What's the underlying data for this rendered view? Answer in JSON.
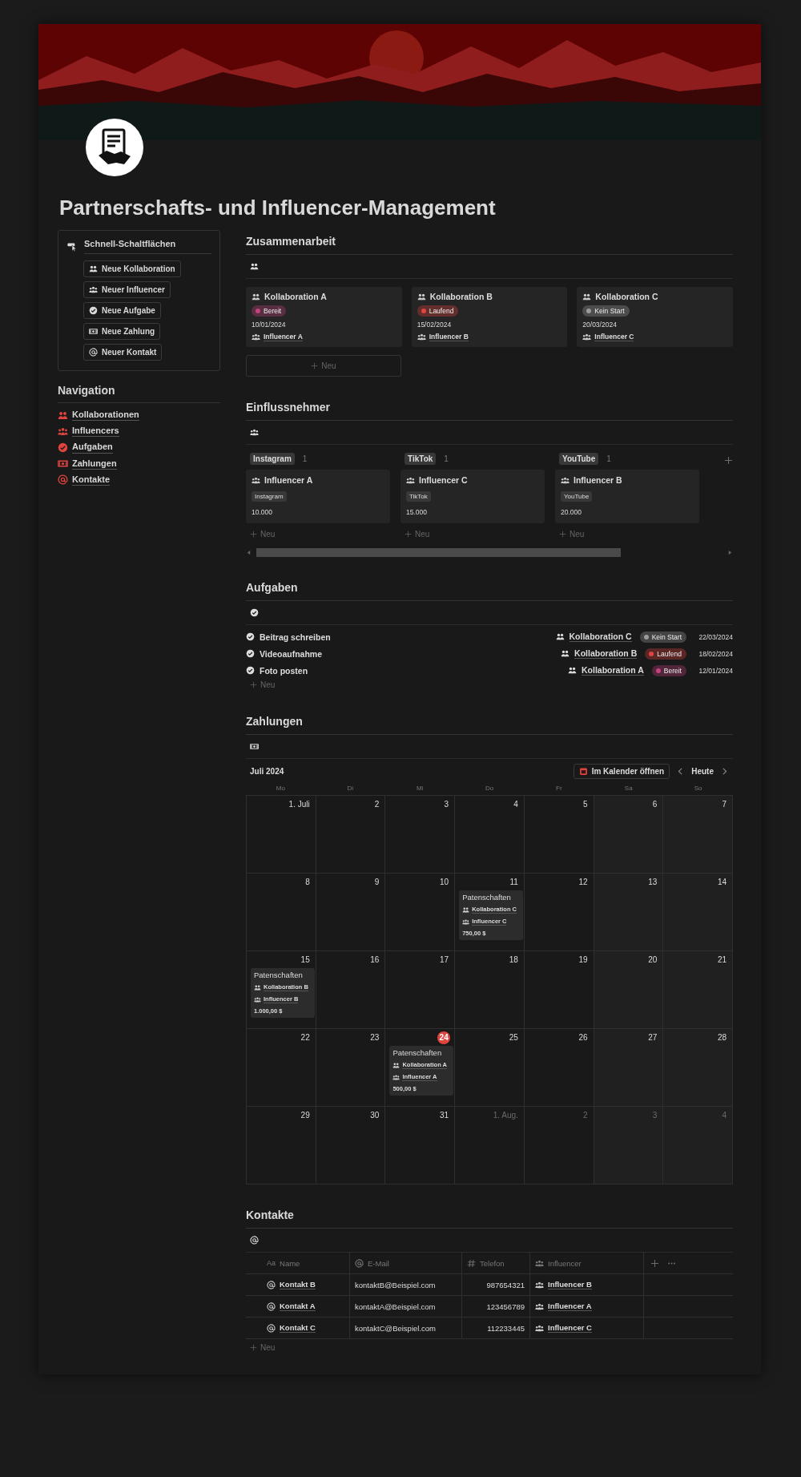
{
  "title": "Partnerschafts- und Influencer-Management",
  "quick_actions": {
    "title": "Schnell-Schaltflächen",
    "buttons": [
      {
        "label": "Neue Kollaboration",
        "kind": "collab"
      },
      {
        "label": "Neuer Influencer",
        "kind": "influencer"
      },
      {
        "label": "Neue Aufgabe",
        "kind": "task"
      },
      {
        "label": "Neue Zahlung",
        "kind": "payment"
      },
      {
        "label": "Neuer Kontakt",
        "kind": "contact"
      }
    ]
  },
  "navigation": {
    "title": "Navigation",
    "links": [
      {
        "label": "Kollaborationen",
        "kind": "collab"
      },
      {
        "label": "Influencers",
        "kind": "influencer"
      },
      {
        "label": "Aufgaben",
        "kind": "task"
      },
      {
        "label": "Zahlungen",
        "kind": "payment"
      },
      {
        "label": "Kontakte",
        "kind": "contact"
      }
    ]
  },
  "collaboration": {
    "title": "Zusammenarbeit",
    "new_label": "Neu",
    "cards": [
      {
        "name": "Kollaboration A",
        "status": {
          "label": "Bereit",
          "color": "#c4437f"
        },
        "date": "10/01/2024",
        "influencer": "Influencer A"
      },
      {
        "name": "Kollaboration B",
        "status": {
          "label": "Laufend",
          "color": "#e0443e"
        },
        "date": "15/02/2024",
        "influencer": "Influencer B"
      },
      {
        "name": "Kollaboration C",
        "status": {
          "label": "Kein Start",
          "color": "#9b9b9b"
        },
        "date": "20/03/2024",
        "influencer": "Influencer C"
      }
    ]
  },
  "influencers": {
    "title": "Einflussnehmer",
    "groups": [
      {
        "label": "Instagram",
        "count": "1",
        "new_label": "Neu",
        "cards": [
          {
            "name": "Influencer A",
            "platform": "Instagram",
            "followers": "10.000"
          }
        ]
      },
      {
        "label": "TikTok",
        "count": "1",
        "new_label": "Neu",
        "cards": [
          {
            "name": "Influencer C",
            "platform": "TikTok",
            "followers": "15.000"
          }
        ]
      },
      {
        "label": "YouTube",
        "count": "1",
        "new_label": "Neu",
        "cards": [
          {
            "name": "Influencer B",
            "platform": "YouTube",
            "followers": "20.000"
          }
        ]
      }
    ]
  },
  "tasks": {
    "title": "Aufgaben",
    "new_label": "Neu",
    "rows": [
      {
        "name": "Beitrag schreiben",
        "collaboration": "Kollaboration C",
        "status": {
          "label": "Kein Start",
          "color": "#9b9b9b"
        },
        "date": "22/03/2024"
      },
      {
        "name": "Videoaufnahme",
        "collaboration": "Kollaboration B",
        "status": {
          "label": "Laufend",
          "color": "#e0443e"
        },
        "date": "18/02/2024"
      },
      {
        "name": "Foto posten",
        "collaboration": "Kollaboration A",
        "status": {
          "label": "Bereit",
          "color": "#c4437f"
        },
        "date": "12/01/2024"
      }
    ]
  },
  "payments": {
    "title": "Zahlungen",
    "month": "Juli 2024",
    "open_button": "Im Kalender öffnen",
    "today_button": "Heute",
    "weekdays": [
      "Mo",
      "Di",
      "Mi",
      "Do",
      "Fr",
      "Sa",
      "So"
    ],
    "days": [
      {
        "label": "1. Juli",
        "in_month": true,
        "today": false
      },
      {
        "label": "2",
        "in_month": true,
        "today": false
      },
      {
        "label": "3",
        "in_month": true,
        "today": false
      },
      {
        "label": "4",
        "in_month": true,
        "today": false
      },
      {
        "label": "5",
        "in_month": true,
        "today": false
      },
      {
        "label": "6",
        "in_month": true,
        "today": false
      },
      {
        "label": "7",
        "in_month": true,
        "today": false
      },
      {
        "label": "8",
        "in_month": true,
        "today": false
      },
      {
        "label": "9",
        "in_month": true,
        "today": false
      },
      {
        "label": "10",
        "in_month": true,
        "today": false
      },
      {
        "label": "11",
        "in_month": true,
        "today": false,
        "events": [
          {
            "title": "Patenschaften",
            "collaboration": "Kollaboration C",
            "influencer": "Influencer C",
            "amount": "750,00 $"
          }
        ]
      },
      {
        "label": "12",
        "in_month": true,
        "today": false
      },
      {
        "label": "13",
        "in_month": true,
        "today": false
      },
      {
        "label": "14",
        "in_month": true,
        "today": false
      },
      {
        "label": "15",
        "in_month": true,
        "today": false,
        "events": [
          {
            "title": "Patenschaften",
            "collaboration": "Kollaboration B",
            "influencer": "Influencer B",
            "amount": "1.000,00 $"
          }
        ]
      },
      {
        "label": "16",
        "in_month": true,
        "today": false
      },
      {
        "label": "17",
        "in_month": true,
        "today": false
      },
      {
        "label": "18",
        "in_month": true,
        "today": false
      },
      {
        "label": "19",
        "in_month": true,
        "today": false
      },
      {
        "label": "20",
        "in_month": true,
        "today": false
      },
      {
        "label": "21",
        "in_month": true,
        "today": false
      },
      {
        "label": "22",
        "in_month": true,
        "today": false
      },
      {
        "label": "23",
        "in_month": true,
        "today": false
      },
      {
        "label": "24",
        "in_month": true,
        "today": true,
        "events": [
          {
            "title": "Patenschaften",
            "collaboration": "Kollaboration A",
            "influencer": "Influencer A",
            "amount": "500,00 $"
          }
        ]
      },
      {
        "label": "25",
        "in_month": true,
        "today": false
      },
      {
        "label": "26",
        "in_month": true,
        "today": false
      },
      {
        "label": "27",
        "in_month": true,
        "today": false
      },
      {
        "label": "28",
        "in_month": true,
        "today": false
      },
      {
        "label": "29",
        "in_month": true,
        "today": false
      },
      {
        "label": "30",
        "in_month": true,
        "today": false
      },
      {
        "label": "31",
        "in_month": true,
        "today": false
      },
      {
        "label": "1. Aug.",
        "in_month": false,
        "today": false
      },
      {
        "label": "2",
        "in_month": false,
        "today": false
      },
      {
        "label": "3",
        "in_month": false,
        "today": false
      },
      {
        "label": "4",
        "in_month": false,
        "today": false
      }
    ]
  },
  "contacts": {
    "title": "Kontakte",
    "new_label": "Neu",
    "columns": [
      {
        "label": "Name",
        "kind": "title",
        "glyph": "Aa"
      },
      {
        "label": "E-Mail",
        "kind": "email"
      },
      {
        "label": "Telefon",
        "kind": "number"
      },
      {
        "label": "Influencer",
        "kind": "relation"
      }
    ],
    "rows": [
      {
        "name": "Kontakt B",
        "email": "kontaktB@Beispiel.com",
        "phone": "987654321",
        "influencer": "Influencer B"
      },
      {
        "name": "Kontakt A",
        "email": "kontaktA@Beispiel.com",
        "phone": "123456789",
        "influencer": "Influencer A"
      },
      {
        "name": "Kontakt C",
        "email": "kontaktC@Beispiel.com",
        "phone": "112233445",
        "influencer": "Influencer C"
      }
    ]
  }
}
